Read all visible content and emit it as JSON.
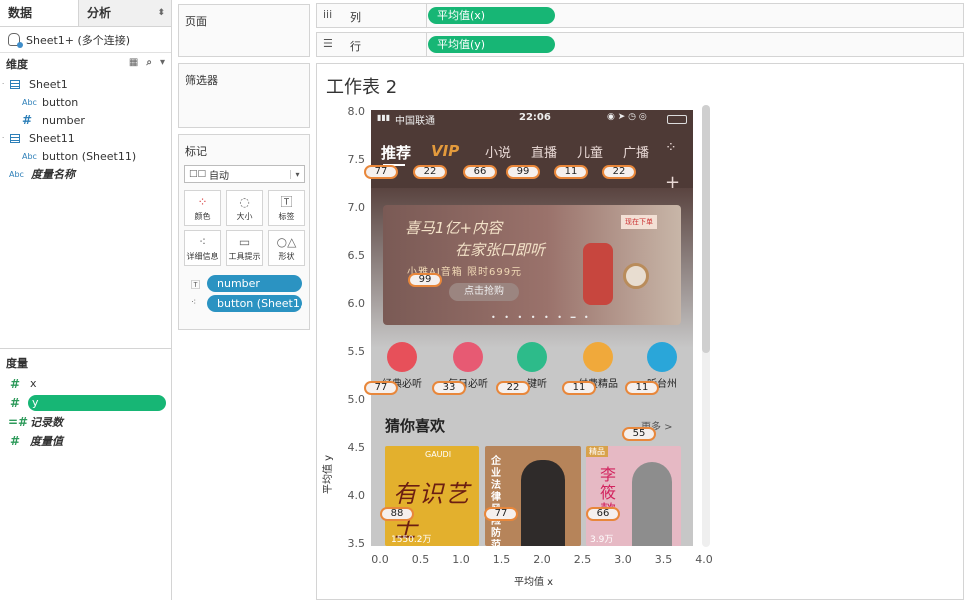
{
  "left_pane": {
    "tab_data": "数据",
    "tab_analysis": "分析",
    "connection": "Sheet1+ (多个连接)",
    "dimensions_title": "维度",
    "dimensions": [
      {
        "label": "Sheet1",
        "kind": "table"
      },
      {
        "label": "button",
        "kind": "abc"
      },
      {
        "label": "number",
        "kind": "hash"
      },
      {
        "label": "Sheet11",
        "kind": "table"
      },
      {
        "label": "button (Sheet11)",
        "kind": "abc"
      },
      {
        "label": "度量名称",
        "kind": "abc"
      }
    ],
    "measures_title": "度量",
    "measures": [
      {
        "label": "x"
      },
      {
        "label": "y"
      },
      {
        "label": "记录数"
      },
      {
        "label": "度量值"
      }
    ]
  },
  "cards": {
    "pages": "页面",
    "filters": "筛选器",
    "marks": "标记",
    "mark_type": "自动",
    "buttons": [
      "颜色",
      "大小",
      "标签",
      "详细信息",
      "工具提示",
      "形状"
    ],
    "pills": [
      "number",
      "button (Sheet1.."
    ]
  },
  "shelves": {
    "columns_label": "列",
    "columns_pill": "平均值(x)",
    "rows_label": "行",
    "rows_pill": "平均值(y)"
  },
  "worksheet": {
    "title": "工作表 2",
    "x_label": "平均值 x",
    "y_label": "平均值 y",
    "y_ticks": [
      "8.0",
      "7.5",
      "7.0",
      "6.5",
      "6.0",
      "5.5",
      "5.0",
      "4.5",
      "4.0",
      "3.5"
    ],
    "x_ticks": [
      "0.0",
      "0.5",
      "1.0",
      "1.5",
      "2.0",
      "2.5",
      "3.0",
      "3.5",
      "4.0"
    ],
    "labels": [
      "77",
      "22",
      "66",
      "99",
      "11",
      "22",
      "99",
      "77",
      "33",
      "22",
      "11",
      "11",
      "55",
      "88",
      "77",
      "66"
    ]
  },
  "phone": {
    "carrier": "中国联通",
    "time": "22:06",
    "nav": [
      "推荐",
      "VIP",
      "小说",
      "直播",
      "儿童",
      "广播"
    ],
    "banner_line1": "喜马1亿+内容",
    "banner_line2": "在家张口即听",
    "banner_line3": "小雅AI音箱 限时699元",
    "banner_cta": "点击抢购",
    "banner_tag": "现在下单",
    "categories": [
      "经典必听",
      "每日必听",
      "一键听",
      "付费精品",
      "听台州"
    ],
    "section_title": "猜你喜欢",
    "more": "更多 >",
    "book1_title": "有识艺士",
    "book1_brand": "GAUDI",
    "book1_plays": "1550.2万",
    "book2_title": "企业法律风险防范",
    "book3_title": "李筱懿",
    "book3_badge": "精品",
    "book3_plays": "3.9万"
  },
  "colors": {
    "green_pill": "#17b675",
    "blue_pill": "#2b93c2",
    "label_border": "#e8873b"
  }
}
